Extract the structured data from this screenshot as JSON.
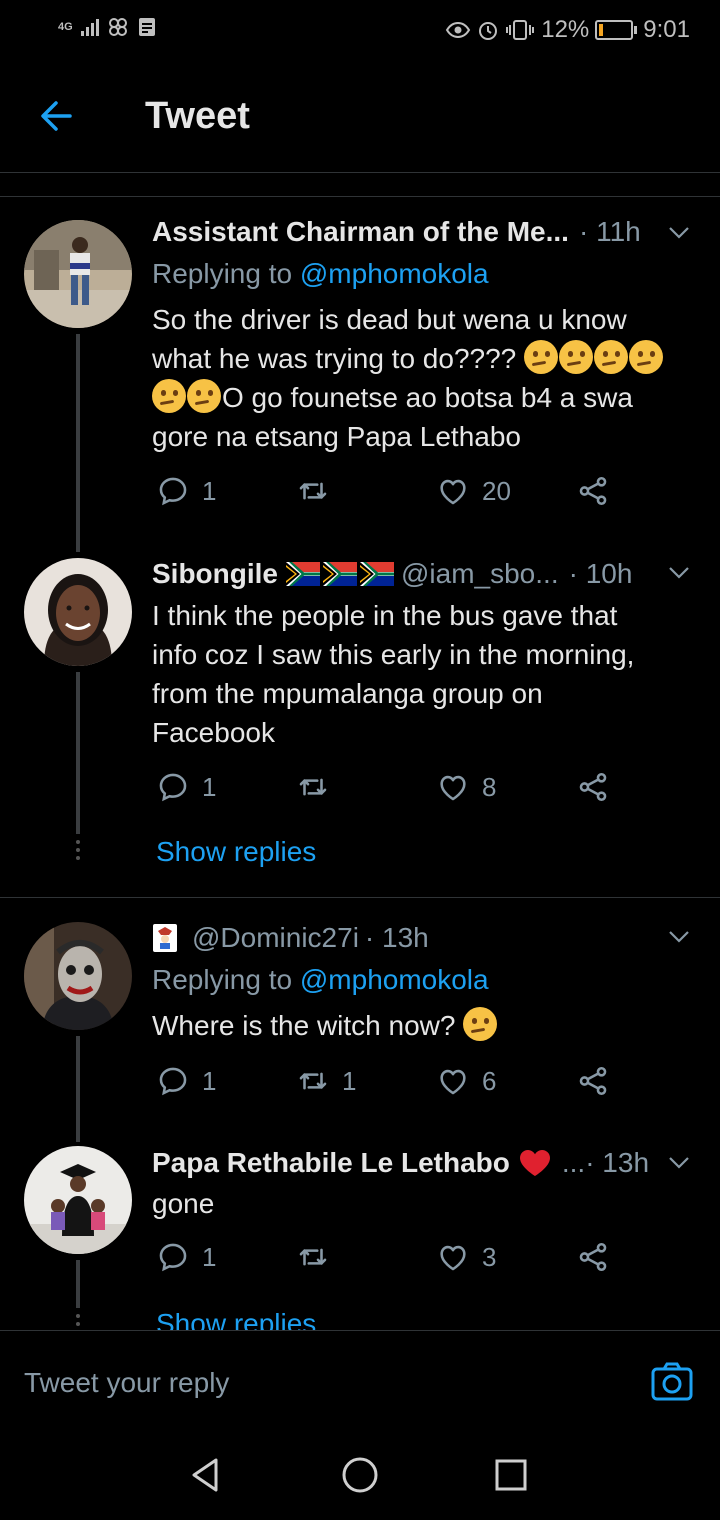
{
  "status": {
    "network": "4G",
    "battery_percent": "12%",
    "battery_level": 0.12,
    "time": "9:01"
  },
  "header": {
    "title": "Tweet"
  },
  "tweets": [
    {
      "name": "Assistant Chairman of the Me...",
      "time": "· 11h",
      "replying_prefix": "Replying to ",
      "replying_to": "@mphomokola",
      "text_line1": "So the driver is dead but wena u know",
      "text_line2": "what he was trying to do????",
      "text_line3": "O go founetse ao botsa b4 a swa",
      "text_line4": "gore na etsang Papa Lethabo",
      "replies": "1",
      "retweets": "",
      "likes": "20"
    },
    {
      "name": "Sibongile",
      "handle": "@iam_sbo...",
      "time": "· 10h",
      "text_line1": "I think the people in the bus gave that",
      "text_line2": "info coz I saw this early in the morning,",
      "text_line3": "from the mpumalanga group on",
      "text_line4": "Facebook",
      "replies": "1",
      "retweets": "",
      "likes": "8",
      "show_replies": "Show replies"
    },
    {
      "handle": "@Dominic27i",
      "time": "· 13h",
      "replying_prefix": "Replying to ",
      "replying_to": "@mphomokola",
      "text": "Where is the witch now?",
      "replies": "1",
      "retweets": "1",
      "likes": "6"
    },
    {
      "name": "Papa Rethabile Le Lethabo",
      "handle_trunc": "...",
      "time": "· 13h",
      "text": "gone",
      "replies": "1",
      "retweets": "",
      "likes": "3",
      "show_replies": "Show replies"
    }
  ],
  "composer": {
    "placeholder": "Tweet your reply"
  },
  "colors": {
    "accent": "#1da1f2",
    "muted": "#8899a6",
    "background": "#000000"
  }
}
